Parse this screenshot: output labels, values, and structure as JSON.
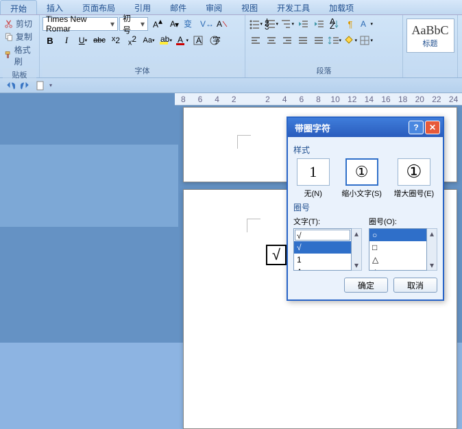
{
  "tabs": [
    "开始",
    "插入",
    "页面布局",
    "引用",
    "邮件",
    "审阅",
    "视图",
    "开发工具",
    "加载项"
  ],
  "active_tab": 0,
  "clipboard": {
    "cut": "剪切",
    "copy": "复制",
    "fmt": "格式刷",
    "label": "贴板"
  },
  "font": {
    "name": "Times New Romar",
    "size": "初号",
    "label": "字体"
  },
  "para": {
    "label": "段落"
  },
  "styles": {
    "sample": "AaBbC",
    "name": "标题"
  },
  "ruler_nums": [
    "8",
    "6",
    "4",
    "2",
    "",
    "2",
    "4",
    "6",
    "8",
    "10",
    "12",
    "14",
    "16",
    "18",
    "20",
    "22",
    "24"
  ],
  "page_symbol": "√",
  "dialog": {
    "title": "带圈字符",
    "section_style": "样式",
    "opts": [
      {
        "glyph": "1",
        "label": "无(N)"
      },
      {
        "glyph": "①",
        "label": "缩小文字(S)"
      },
      {
        "glyph": "①",
        "label": "增大圈号(E)"
      }
    ],
    "opt_selected": 1,
    "section_enc": "圈号",
    "col1_label": "文字(T):",
    "col2_label": "圈号(O):",
    "text_items": [
      "√",
      "√",
      "1",
      "A"
    ],
    "text_sel": 1,
    "enc_items": [
      "○",
      "□",
      "△",
      "◇"
    ],
    "enc_sel": 0,
    "ok": "确定",
    "cancel": "取消"
  }
}
